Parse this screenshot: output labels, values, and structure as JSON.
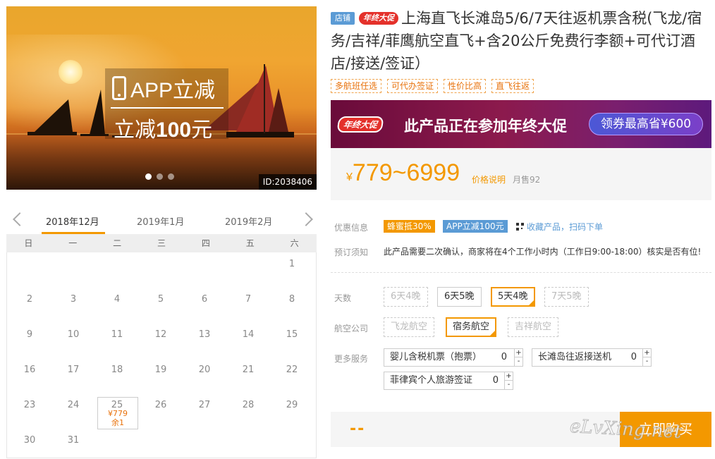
{
  "hero": {
    "promo_line1": "APP立减",
    "promo_line2_prefix": "立减",
    "promo_line2_amount": "100",
    "promo_line2_suffix": "元",
    "image_id": "ID:2038406",
    "carousel_dots": 3,
    "active_dot": 0
  },
  "calendar": {
    "months": [
      "2018年12月",
      "2019年1月",
      "2019年2月"
    ],
    "active_month": 0,
    "weekdays": [
      "日",
      "一",
      "二",
      "三",
      "四",
      "五",
      "六"
    ],
    "selected_day": {
      "day": "25",
      "price": "¥779",
      "stock": "余1"
    },
    "days": [
      "1",
      "2",
      "3",
      "4",
      "5",
      "6",
      "7",
      "8",
      "9",
      "10",
      "11",
      "12",
      "13",
      "14",
      "15",
      "16",
      "17",
      "18",
      "19",
      "20",
      "21",
      "22",
      "23",
      "24",
      "25",
      "26",
      "27",
      "28",
      "29",
      "30",
      "31"
    ]
  },
  "product": {
    "shop_tag": "店铺",
    "event_tag": "年终大促",
    "title": "上海直飞长滩岛5/6/7天往返机票含税(飞龙/宿务/吉祥/菲鹰航空直飞+含20公斤免费行李额+可代订酒店/接送/签证）",
    "features": [
      "多航班任选",
      "可代办签证",
      "性价比高",
      "直飞往返"
    ]
  },
  "promo_banner": {
    "badge": "年终大促",
    "text": "此产品正在参加年终大促",
    "button": "领券最高省¥600"
  },
  "pricing": {
    "currency": "¥",
    "range": "779~6999",
    "price_note": "价格说明",
    "monthly_sales": "月售92"
  },
  "offers": {
    "label": "优惠信息",
    "badge1": "蜂蜜抵30%",
    "badge2": "APP立减100元",
    "collect": "收藏产品，扫码下单"
  },
  "booking_notice": {
    "label": "预订须知",
    "text": "此产品需要二次确认，商家将在4个工作小时内（工作日9:00-18:00）核实是否有位!"
  },
  "options": {
    "days_label": "天数",
    "days": [
      "6天4晚",
      "6天5晚",
      "5天4晚",
      "7天5晚"
    ],
    "airline_label": "航空公司",
    "airlines": [
      "飞龙航空",
      "宿务航空",
      "吉祥航空"
    ],
    "services_label": "更多服务",
    "services": [
      {
        "name": "婴儿含税机票（抱票）",
        "qty": "0"
      },
      {
        "name": "长滩岛往返接送机",
        "qty": "0"
      },
      {
        "name": "菲律宾个人旅游签证",
        "qty": "0"
      }
    ],
    "stepper_plus": "+",
    "stepper_minus": "-"
  },
  "buy": {
    "total": "--",
    "button": "立即购买"
  },
  "watermark": "eLvXing.net",
  "colors": {
    "accent": "#f39800",
    "blue": "#5b9bd5",
    "red": "#e4312b",
    "promo_bg": "#7a1f5a"
  }
}
